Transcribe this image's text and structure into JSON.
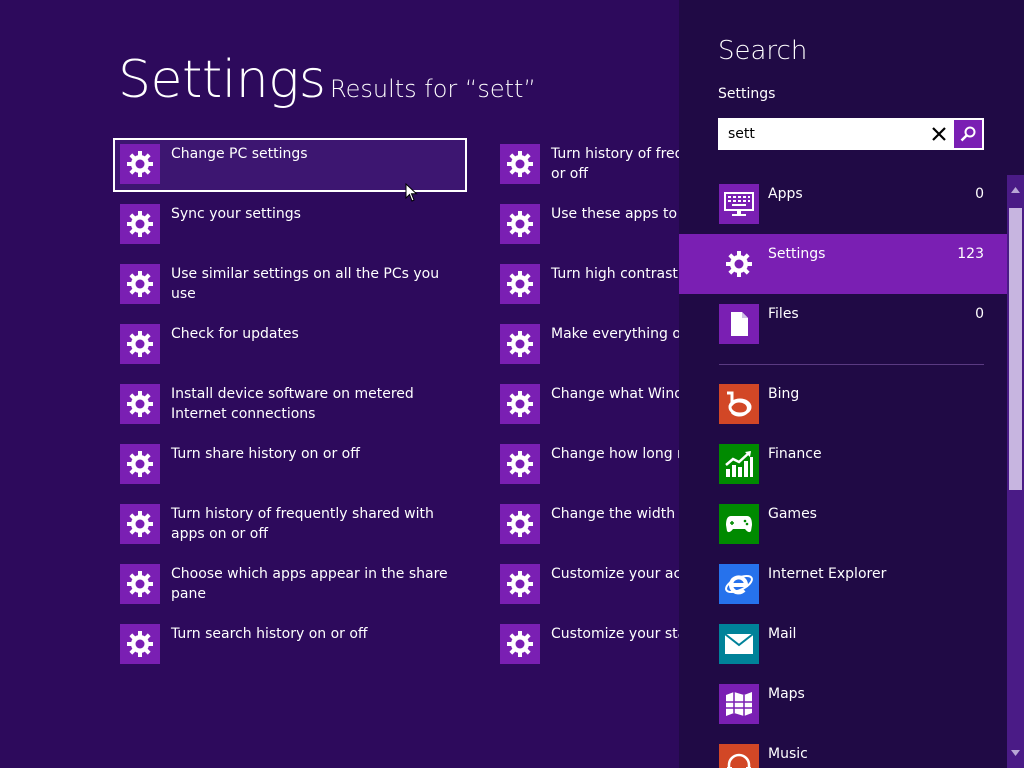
{
  "main": {
    "title": "Settings",
    "results_label": "Results for “sett”",
    "results_left": [
      {
        "label": "Change PC settings",
        "selected": true
      },
      {
        "label": "Sync your settings"
      },
      {
        "label": "Use similar settings on all the PCs you use"
      },
      {
        "label": "Check for updates"
      },
      {
        "label": "Install device software on metered Internet connections"
      },
      {
        "label": "Turn share history on or off"
      },
      {
        "label": "Turn history of frequently shared with apps on or off"
      },
      {
        "label": "Choose which apps appear in the share pane"
      },
      {
        "label": "Turn search history on or off"
      }
    ],
    "results_right": [
      {
        "label": "Turn history of frequ\nor off"
      },
      {
        "label": "Use these apps to se"
      },
      {
        "label": "Turn high contrast c"
      },
      {
        "label": "Make everything on"
      },
      {
        "label": "Change what Windo"
      },
      {
        "label": "Change how long n"
      },
      {
        "label": "Change the width o"
      },
      {
        "label": "Customize your acc"
      },
      {
        "label": "Customize your star"
      }
    ],
    "result_icon": "gear-icon"
  },
  "charm": {
    "title": "Search",
    "scope": "Settings",
    "query": "sett",
    "clear_icon": "close-icon",
    "go_icon": "search-icon",
    "categories": [
      {
        "label": "Apps",
        "count": "0",
        "icon": "keyboard-icon"
      },
      {
        "label": "Settings",
        "count": "123",
        "icon": "gear-icon",
        "active": true
      },
      {
        "label": "Files",
        "count": "0",
        "icon": "file-icon"
      }
    ],
    "apps": [
      {
        "label": "Bing",
        "icon": "bing-icon",
        "color": "#d24726"
      },
      {
        "label": "Finance",
        "icon": "finance-icon",
        "color": "#008a00"
      },
      {
        "label": "Games",
        "icon": "games-icon",
        "color": "#008a00"
      },
      {
        "label": "Internet Explorer",
        "icon": "internet-explorer-icon",
        "color": "#2672ec"
      },
      {
        "label": "Mail",
        "icon": "mail-icon",
        "color": "#008299"
      },
      {
        "label": "Maps",
        "icon": "maps-icon",
        "color": "#7a1fb3"
      },
      {
        "label": "Music",
        "icon": "music-icon",
        "color": "#d24726"
      }
    ]
  },
  "colors": {
    "background": "#2d0a5c",
    "charm_background": "#200a45",
    "accent": "#7a1fb3"
  }
}
